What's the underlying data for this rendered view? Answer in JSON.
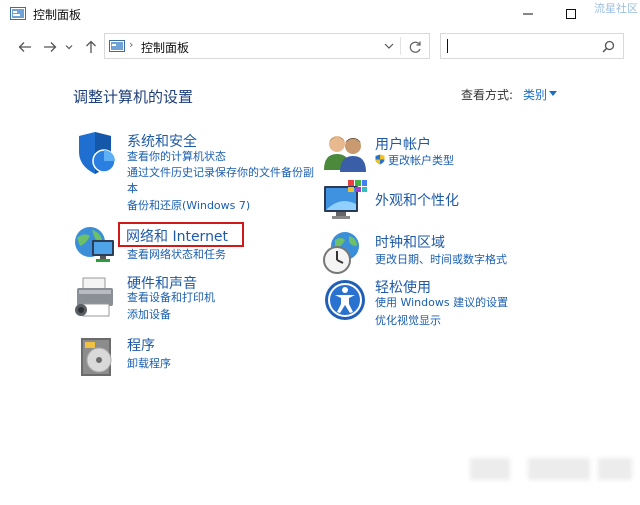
{
  "window": {
    "title": "控制面板",
    "watermark": "流星社区"
  },
  "address": {
    "breadcrumb": "控制面板",
    "search_value": ""
  },
  "content": {
    "heading": "调整计算机的设置",
    "view_by_label": "查看方式:",
    "view_by_value": "类别"
  },
  "categories": {
    "system": {
      "title": "系统和安全",
      "links": [
        "查看你的计算机状态",
        "通过文件历史记录保存你的文件备份副",
        "本",
        "备份和还原(Windows 7)"
      ],
      "icon": "shield-icon"
    },
    "network": {
      "title": "网络和 Internet",
      "links": [
        "查看网络状态和任务"
      ],
      "icon": "network-globe-icon"
    },
    "hardware": {
      "title": "硬件和声音",
      "links": [
        "查看设备和打印机",
        "添加设备"
      ],
      "icon": "printer-icon"
    },
    "programs": {
      "title": "程序",
      "links": [
        "卸载程序"
      ],
      "icon": "programs-disk-icon"
    },
    "users": {
      "title": "用户帐户",
      "links": [
        "更改帐户类型"
      ],
      "icon": "users-icon"
    },
    "appearance": {
      "title": "外观和个性化",
      "links": [],
      "icon": "monitor-palette-icon"
    },
    "clock": {
      "title": "时钟和区域",
      "links": [
        "更改日期、时间或数字格式"
      ],
      "icon": "clock-globe-icon"
    },
    "ease": {
      "title": "轻松使用",
      "links": [
        "使用 Windows 建议的设置",
        "优化视觉显示"
      ],
      "icon": "ease-of-access-icon"
    }
  },
  "colors": {
    "link": "#1a5fb0",
    "heading": "#1e3f7a",
    "highlight_border": "#d01a1a"
  }
}
